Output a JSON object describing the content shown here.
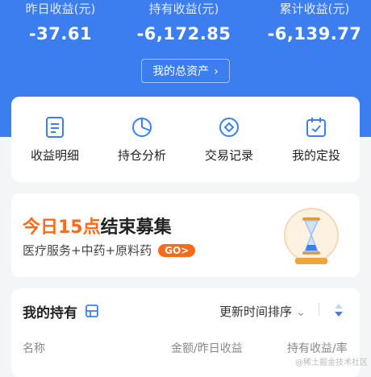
{
  "header": {
    "stats": [
      {
        "label": "昨日收益(元)",
        "value": "-37.61"
      },
      {
        "label": "持有收益(元)",
        "value": "-6,172.85"
      },
      {
        "label": "累计收益(元)",
        "value": "-6,139.77"
      }
    ],
    "asset_button": "我的总资产"
  },
  "quick_actions": [
    {
      "label": "收益明细",
      "icon": "document-icon"
    },
    {
      "label": "持仓分析",
      "icon": "pie-chart-icon"
    },
    {
      "label": "交易记录",
      "icon": "diamond-circle-icon"
    },
    {
      "label": "我的定投",
      "icon": "calendar-check-icon"
    }
  ],
  "promo": {
    "title_highlight": "今日15点",
    "title_rest": "结束募集",
    "subtitle": "医疗服务+中药+原料药",
    "go_label": "GO>"
  },
  "holdings": {
    "title": "我的持有",
    "sort_label": "更新时间排序",
    "columns": [
      "名称",
      "金额/昨日收益",
      "持有收益/率"
    ]
  },
  "watermark": "@稀土掘金技术社区",
  "colors": {
    "primary": "#3c7ef0",
    "accent": "#ff6a1a"
  }
}
